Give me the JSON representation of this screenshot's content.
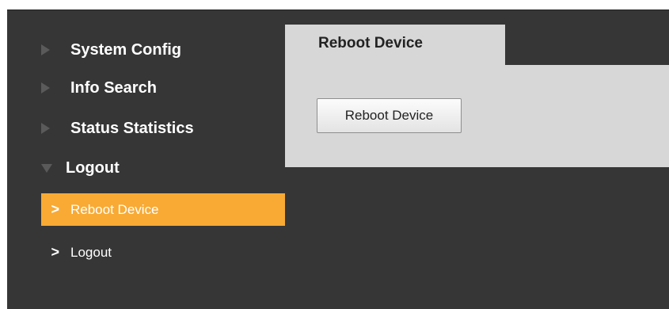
{
  "sidebar": {
    "menus": [
      {
        "label": "System Config",
        "icon": "triangle-right-icon",
        "expanded": false
      },
      {
        "label": "Info Search",
        "icon": "triangle-right-icon",
        "expanded": false
      },
      {
        "label": "Status Statistics",
        "icon": "triangle-right-icon",
        "expanded": false
      },
      {
        "label": "Logout",
        "icon": "triangle-down-icon",
        "expanded": true
      }
    ],
    "submenu": [
      {
        "label": "Reboot Device",
        "active": true,
        "icon": "chevron-right-icon"
      },
      {
        "label": "Logout",
        "active": false,
        "icon": "chevron-right-icon"
      }
    ],
    "chevron_glyph": ">"
  },
  "main": {
    "tab_label": "Reboot Device",
    "reboot_button_label": "Reboot Device"
  },
  "colors": {
    "background": "#363636",
    "active_item": "#f8aa34",
    "panel": "#d7d7d7",
    "text": "#ffffff"
  }
}
